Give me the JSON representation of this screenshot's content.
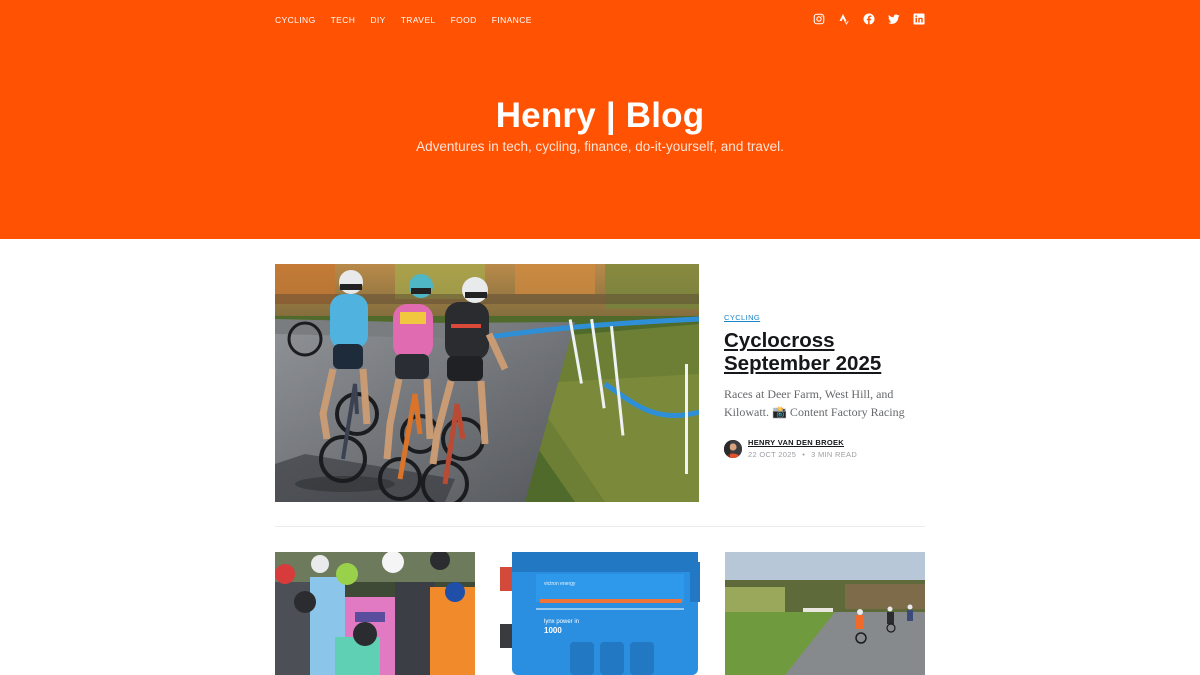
{
  "nav": {
    "items": [
      {
        "label": "CYCLING"
      },
      {
        "label": "TECH"
      },
      {
        "label": "DIY"
      },
      {
        "label": "TRAVEL"
      },
      {
        "label": "FOOD"
      },
      {
        "label": "FINANCE"
      }
    ]
  },
  "social": [
    "instagram-icon",
    "strava-icon",
    "facebook-icon",
    "twitter-icon",
    "linkedin-icon"
  ],
  "brand": {
    "title": "Henry | Blog",
    "tagline": "Adventures in tech, cycling, finance, do-it-yourself, and travel."
  },
  "featured": {
    "tag": "CYCLING",
    "title": "Cyclocross September 2025",
    "excerpt": "Races at Deer Farm, West Hill, and Kilowatt. 📸 Content Factory Racing",
    "author": "HENRY VAN DEN BROEK",
    "date": "22 OCT 2025",
    "separator": "•",
    "read_time": "3 MIN READ"
  },
  "cards": [
    {
      "image": "cyclists-group-photo"
    },
    {
      "image": "lynx-power-in-device-photo",
      "device_brand": "victron energy",
      "device_label": "lynx power in",
      "device_number": "1000"
    },
    {
      "image": "road-cyclists-photo"
    }
  ],
  "colors": {
    "header_bg": "#ff5203",
    "tag": "#1b86c8",
    "text": "#15171a",
    "muted": "#9b9ea3"
  }
}
